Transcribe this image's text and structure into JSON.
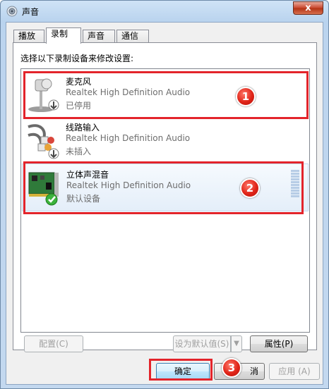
{
  "window": {
    "title": "声音",
    "close_label": "x"
  },
  "tabs": [
    {
      "label": "播放"
    },
    {
      "label": "录制"
    },
    {
      "label": "声音"
    },
    {
      "label": "通信"
    }
  ],
  "instruction": "选择以下录制设备来修改设置:",
  "devices": [
    {
      "name": "麦克风",
      "driver": "Realtek High Definition Audio",
      "status": "已停用",
      "icon": "microphone-icon",
      "badge": "down-arrow-badge"
    },
    {
      "name": "线路输入",
      "driver": "Realtek High Definition Audio",
      "status": "未插入",
      "icon": "line-in-cable-icon",
      "badge": "down-arrow-badge"
    },
    {
      "name": "立体声混音",
      "driver": "Realtek High Definition Audio",
      "status": "默认设备",
      "icon": "sound-card-icon",
      "badge": "checkmark-badge"
    }
  ],
  "buttons": {
    "configure": "配置(C)",
    "set_default": "设为默认值(S)",
    "properties": "属性(P)",
    "ok": "确定",
    "cancel": "消",
    "apply": "应用 (A)"
  },
  "markers": [
    "1",
    "2",
    "3"
  ],
  "colors": {
    "highlight": "#e3242b",
    "marker": "#e02418"
  }
}
